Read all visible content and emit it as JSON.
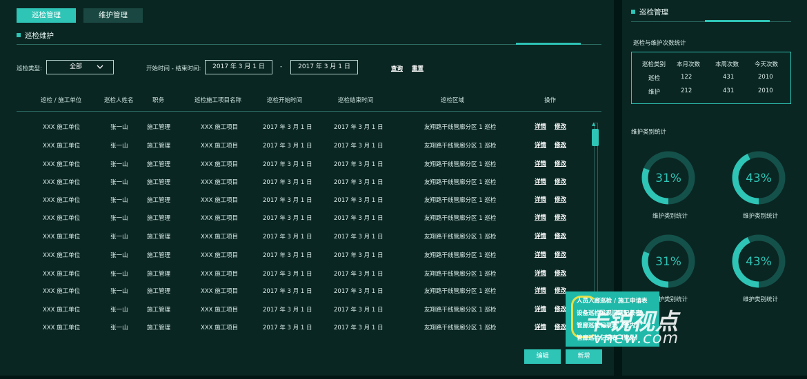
{
  "tabs": [
    {
      "label": "巡检管理",
      "active": true
    },
    {
      "label": "维护管理",
      "active": false
    }
  ],
  "main": {
    "section_title": "巡检维护",
    "filter": {
      "type_label": "巡检类型:",
      "type_value": "全部",
      "time_label": "开始时间 - 结束时间:",
      "start_date": "2017 年 3 月 1 日",
      "end_date": "2017 年 3 月 1 日",
      "separator": "-",
      "query": "查询",
      "reset": "重置"
    },
    "table": {
      "columns": [
        "巡检 / 施工单位",
        "巡检人姓名",
        "职务",
        "巡检施工项目名称",
        "巡检开始时间",
        "巡检结束时间",
        "巡检区域",
        "操作"
      ],
      "rows": [
        {
          "unit": "XXX 施工单位",
          "name": "张一山",
          "duty": "施工管理",
          "project": "XXX 施工项目",
          "start": "2017 年 3 月 1 日",
          "end": "2017 年 3 月 1 日",
          "area": "友翔路干线管廊分区 1 巡检",
          "detail": "详情",
          "edit": "修改"
        },
        {
          "unit": "XXX 施工单位",
          "name": "张一山",
          "duty": "施工管理",
          "project": "XXX 施工项目",
          "start": "2017 年 3 月 1 日",
          "end": "2017 年 3 月 1 日",
          "area": "友翔路干线管廊分区 1 巡检",
          "detail": "详情",
          "edit": "修改"
        },
        {
          "unit": "XXX 施工单位",
          "name": "张一山",
          "duty": "施工管理",
          "project": "XXX 施工项目",
          "start": "2017 年 3 月 1 日",
          "end": "2017 年 3 月 1 日",
          "area": "友翔路干线管廊分区 1 巡检",
          "detail": "详情",
          "edit": "修改"
        },
        {
          "unit": "XXX 施工单位",
          "name": "张一山",
          "duty": "施工管理",
          "project": "XXX 施工项目",
          "start": "2017 年 3 月 1 日",
          "end": "2017 年 3 月 1 日",
          "area": "友翔路干线管廊分区 1 巡检",
          "detail": "详情",
          "edit": "修改"
        },
        {
          "unit": "XXX 施工单位",
          "name": "张一山",
          "duty": "施工管理",
          "project": "XXX 施工项目",
          "start": "2017 年 3 月 1 日",
          "end": "2017 年 3 月 1 日",
          "area": "友翔路干线管廊分区 1 巡检",
          "detail": "详情",
          "edit": "修改"
        },
        {
          "unit": "XXX 施工单位",
          "name": "张一山",
          "duty": "施工管理",
          "project": "XXX 施工项目",
          "start": "2017 年 3 月 1 日",
          "end": "2017 年 3 月 1 日",
          "area": "友翔路干线管廊分区 1 巡检",
          "detail": "详情",
          "edit": "修改"
        },
        {
          "unit": "XXX 施工单位",
          "name": "张一山",
          "duty": "施工管理",
          "project": "XXX 施工项目",
          "start": "2017 年 3 月 1 日",
          "end": "2017 年 3 月 1 日",
          "area": "友翔路干线管廊分区 1 巡检",
          "detail": "详情",
          "edit": "修改"
        },
        {
          "unit": "XXX 施工单位",
          "name": "张一山",
          "duty": "施工管理",
          "project": "XXX 施工项目",
          "start": "2017 年 3 月 1 日",
          "end": "2017 年 3 月 1 日",
          "area": "友翔路干线管廊分区 1 巡检",
          "detail": "详情",
          "edit": "修改"
        },
        {
          "unit": "XXX 施工单位",
          "name": "张一山",
          "duty": "施工管理",
          "project": "XXX 施工项目",
          "start": "2017 年 3 月 1 日",
          "end": "2017 年 3 月 1 日",
          "area": "友翔路干线管廊分区 1 巡检",
          "detail": "详情",
          "edit": "修改"
        },
        {
          "unit": "XXX 施工单位",
          "name": "张一山",
          "duty": "施工管理",
          "project": "XXX 施工项目",
          "start": "2017 年 3 月 1 日",
          "end": "2017 年 3 月 1 日",
          "area": "友翔路干线管廊分区 1 巡检",
          "detail": "详情",
          "edit": "修改"
        },
        {
          "unit": "XXX 施工单位",
          "name": "张一山",
          "duty": "施工管理",
          "project": "XXX 施工项目",
          "start": "2017 年 3 月 1 日",
          "end": "2017 年 3 月 1 日",
          "area": "友翔路干线管廊分区 1 巡检",
          "detail": "详情",
          "edit": "修改"
        },
        {
          "unit": "XXX 施工单位",
          "name": "张一山",
          "duty": "施工管理",
          "project": "XXX 施工项目",
          "start": "2017 年 3 月 1 日",
          "end": "2017 年 3 月 1 日",
          "area": "友翔路干线管廊分区 1 巡检",
          "detail": "详情",
          "edit": "修改"
        }
      ]
    },
    "buttons": {
      "edit": "编辑",
      "add": "新增"
    },
    "popup_menu": [
      "人员入廊巡检 / 施工申请表",
      "设备巡检发现问题记录表",
      "管廊巡检记录表（管内）",
      "管廊巡检记录表（管外）"
    ]
  },
  "sidebar": {
    "section_title": "巡检管理",
    "stats": {
      "title": "巡检与维护次数统计",
      "headers": [
        "巡检类别",
        "本月次数",
        "本周次数",
        "今天次数"
      ],
      "rows": [
        {
          "type": "巡检",
          "month": "122",
          "week": "431",
          "today": "2010"
        },
        {
          "type": "维护",
          "month": "212",
          "week": "431",
          "today": "2010"
        }
      ]
    },
    "maint_title": "维护类别统计",
    "rings": [
      {
        "value": 31,
        "text": "31%",
        "label": "维护类别统计"
      },
      {
        "value": 43,
        "text": "43%",
        "label": "维护类别统计"
      },
      {
        "value": 31,
        "text": "31%",
        "label": "维护类别统计"
      },
      {
        "value": 43,
        "text": "43%",
        "label": "维护类别统计"
      }
    ]
  },
  "watermark": {
    "cn": "卡锐视点",
    "en": "vnew.com"
  },
  "colors": {
    "accent": "#2ec4b6",
    "panel": "#0a2622",
    "background": "#021614",
    "ring_track": "#14514a",
    "watermark_ring": "#e3e04a"
  },
  "icons": {
    "select_chevron": "chevron-down-icon",
    "section_marker": "square-icon",
    "scroll_up": "caret-up-icon"
  }
}
